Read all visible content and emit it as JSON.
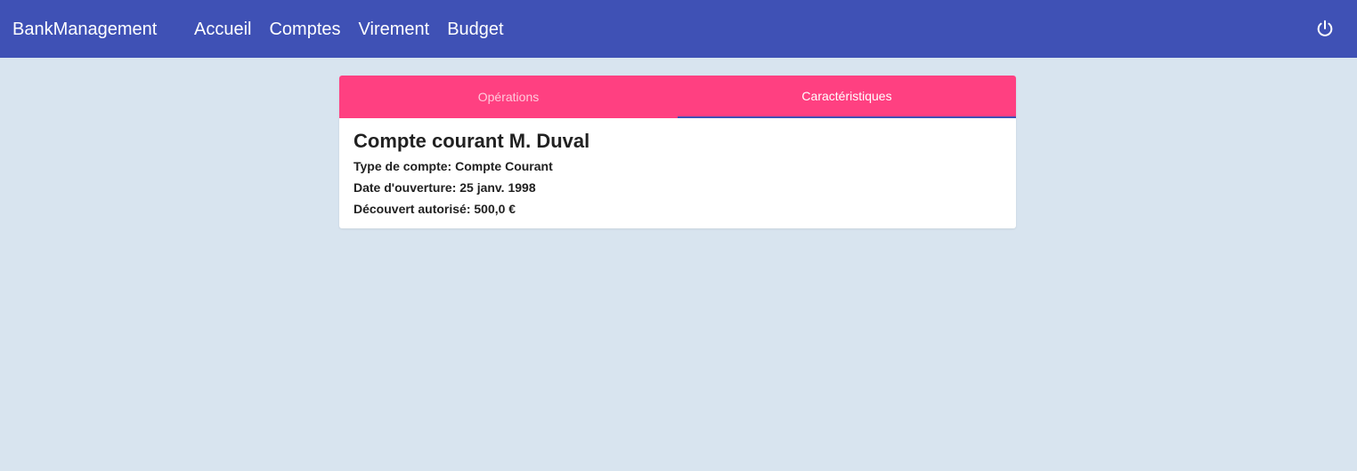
{
  "header": {
    "brand": "BankManagement",
    "nav": [
      "Accueil",
      "Comptes",
      "Virement",
      "Budget"
    ],
    "logout_icon": "power-icon"
  },
  "tabs": {
    "items": [
      "Opérations",
      "Caractéristiques"
    ],
    "active": "Caractéristiques"
  },
  "account": {
    "title": "Compte courant M. Duval",
    "type": "Type de compte: Compte Courant",
    "opening_date": "Date d'ouverture: 25 janv. 1998",
    "overdraft": "Découvert autorisé: 500,0 €"
  },
  "colors": {
    "toolbar": "#3f51b5",
    "tab_bar": "#ff4081",
    "background": "#d8e4ef"
  }
}
